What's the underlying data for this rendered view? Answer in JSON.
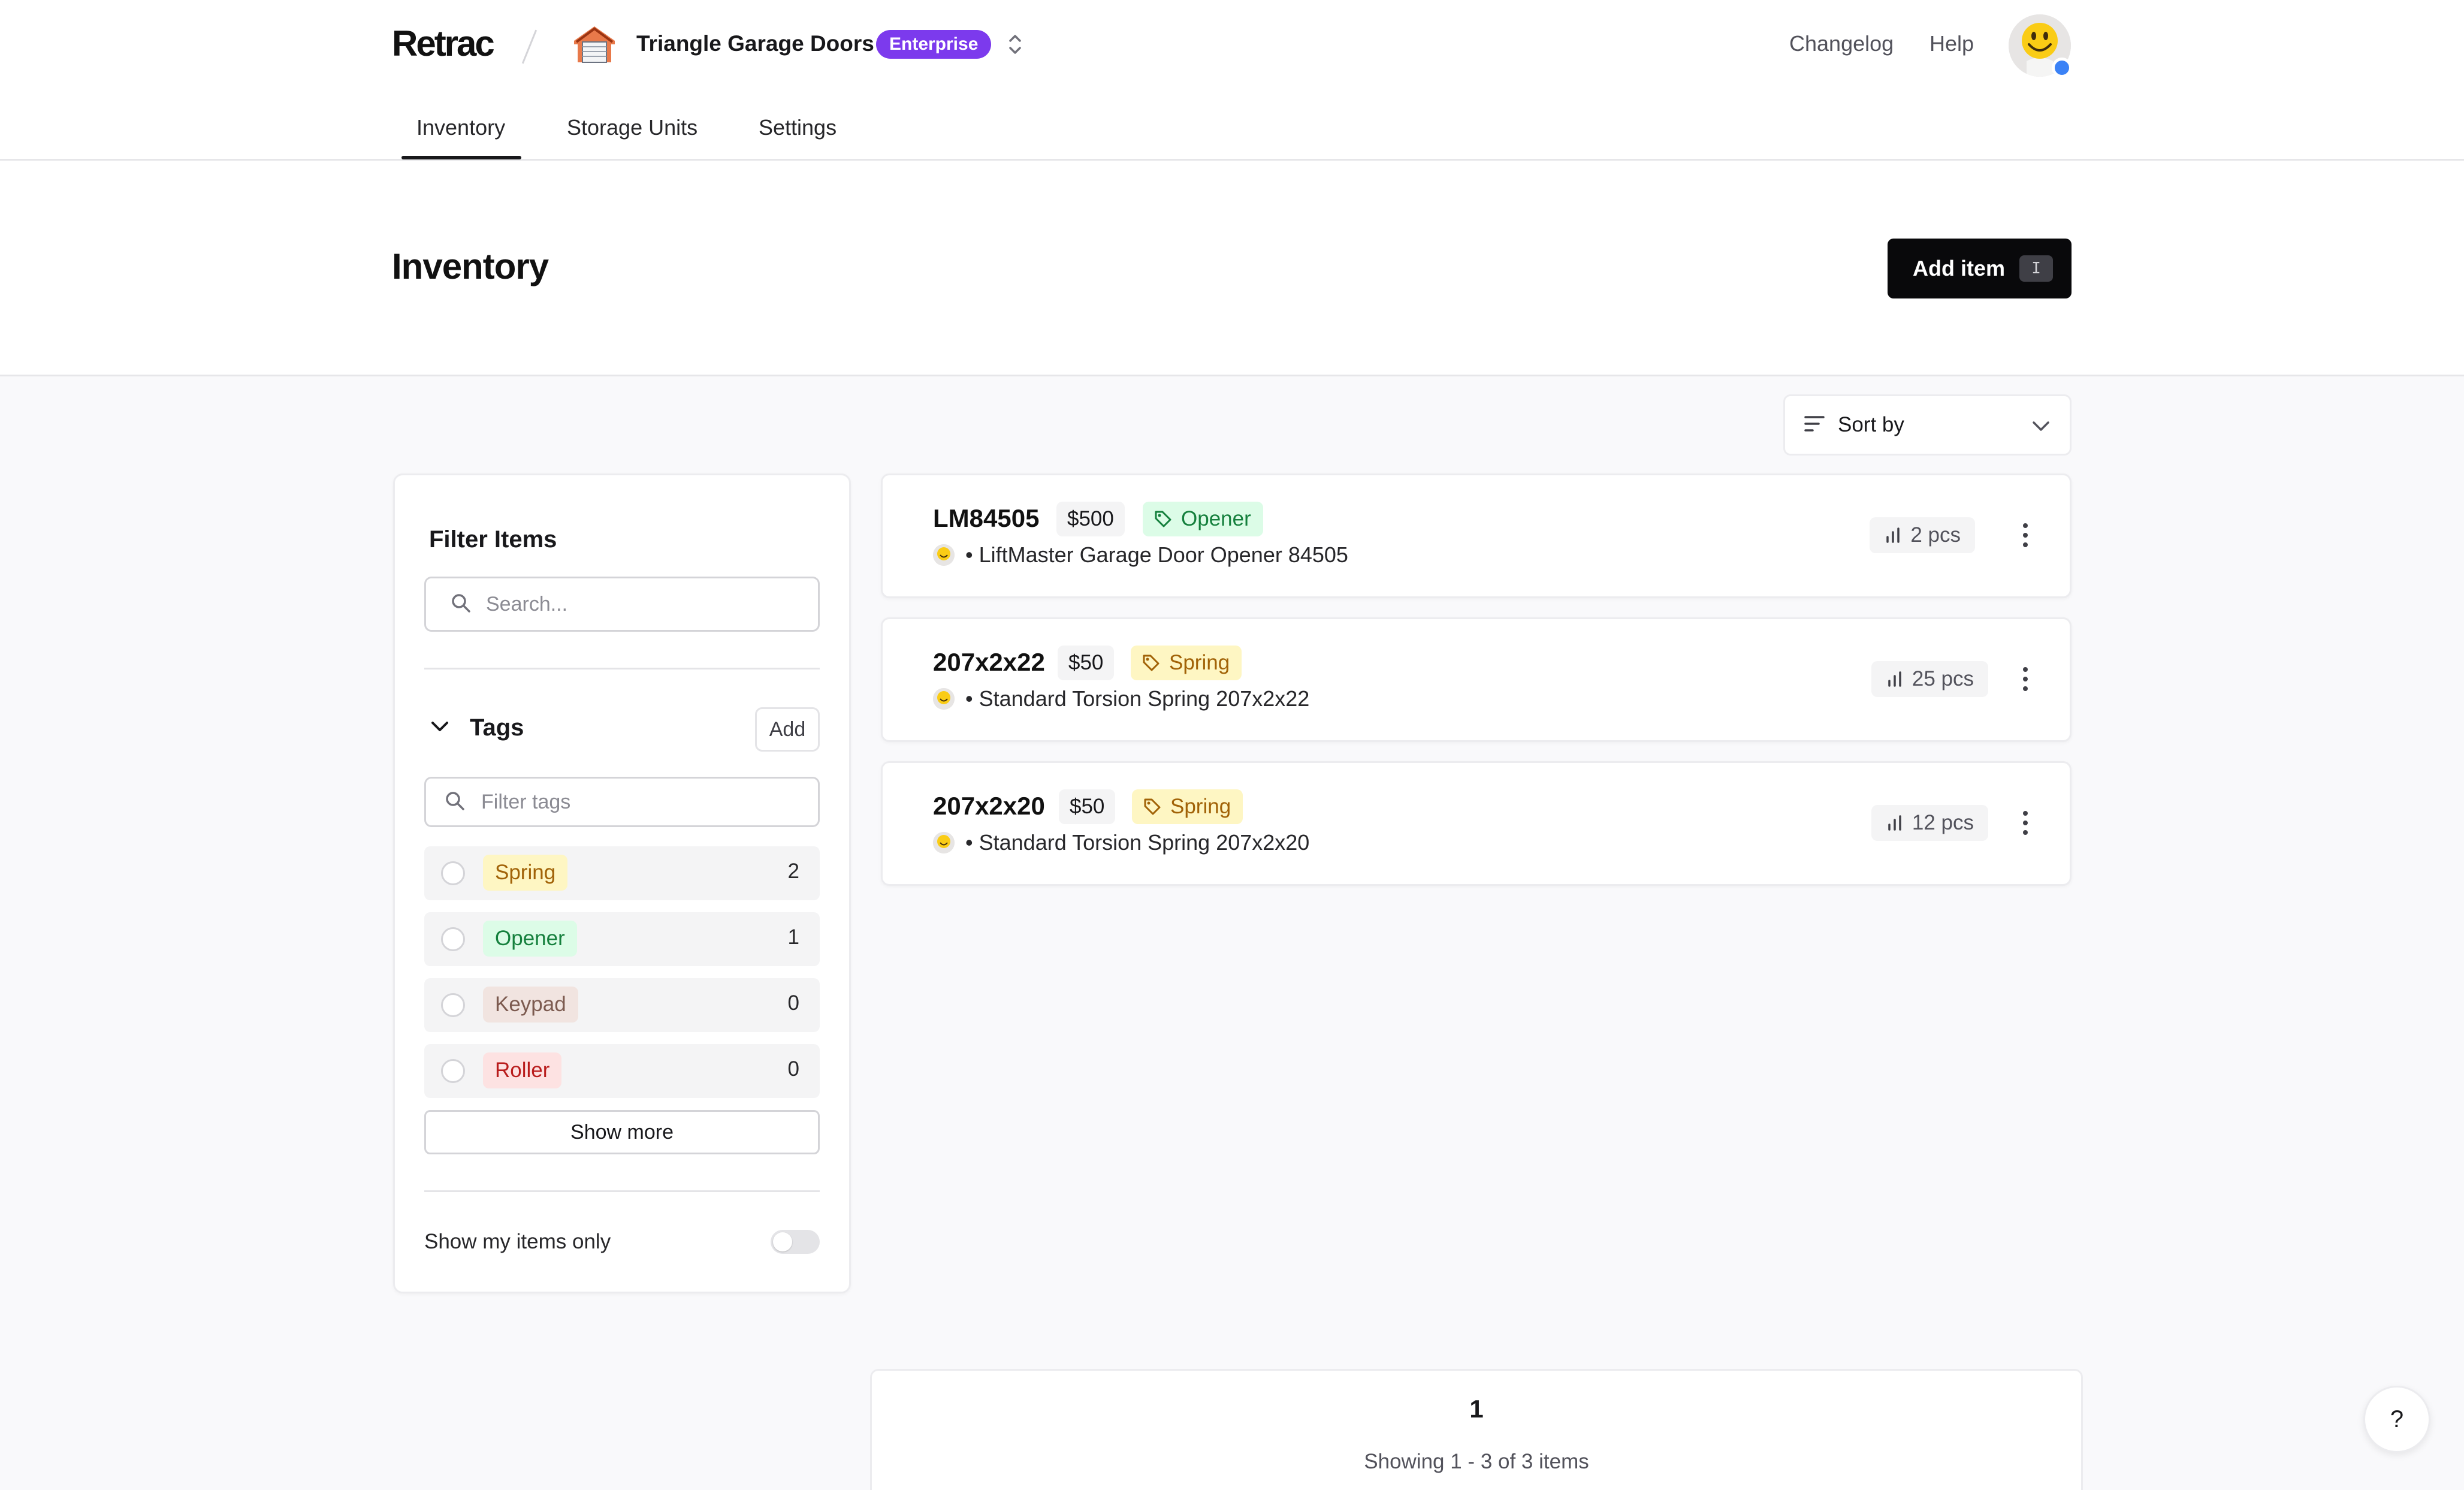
{
  "app": {
    "logo_text": "Retrac"
  },
  "org": {
    "name": "Triangle Garage Doors",
    "plan_badge": "Enterprise"
  },
  "topnav": {
    "changelog": "Changelog",
    "help": "Help"
  },
  "tabs": [
    {
      "label": "Inventory",
      "active": true
    },
    {
      "label": "Storage Units",
      "active": false
    },
    {
      "label": "Settings",
      "active": false
    }
  ],
  "header": {
    "title": "Inventory",
    "add_button": "Add item",
    "add_shortcut": "I"
  },
  "sort": {
    "label": "Sort by"
  },
  "filters": {
    "title": "Filter Items",
    "search_placeholder": "Search...",
    "tags_label": "Tags",
    "tags_add": "Add",
    "tags_filter_placeholder": "Filter tags",
    "tags": [
      {
        "name": "Spring",
        "count": "2",
        "color": "#fef6c3"
      },
      {
        "name": "Opener",
        "count": "1",
        "color": "#dcfce7"
      },
      {
        "name": "Keypad",
        "count": "0",
        "color": "#f1e4e0"
      },
      {
        "name": "Roller",
        "count": "0",
        "color": "#fde2e2"
      }
    ],
    "show_more": "Show more",
    "my_items_label": "Show my items only",
    "my_items_enabled": false
  },
  "items": [
    {
      "code": "LM84505",
      "price": "$500",
      "tag": "Opener",
      "description": "LiftMaster Garage Door Opener 84505",
      "quantity": "2 pcs"
    },
    {
      "code": "207x2x22",
      "price": "$50",
      "tag": "Spring",
      "description": "Standard Torsion Spring 207x2x22",
      "quantity": "25 pcs"
    },
    {
      "code": "207x2x20",
      "price": "$50",
      "tag": "Spring",
      "description": "Standard Torsion Spring 207x2x20",
      "quantity": "12 pcs"
    }
  ],
  "pagination": {
    "current_page": "1",
    "summary": "Showing 1 - 3 of 3 items"
  },
  "help_fab": "?",
  "colors": {
    "accent": "#7c3aed",
    "primary_button": "#09090b",
    "status_dot": "#3b82f6"
  }
}
